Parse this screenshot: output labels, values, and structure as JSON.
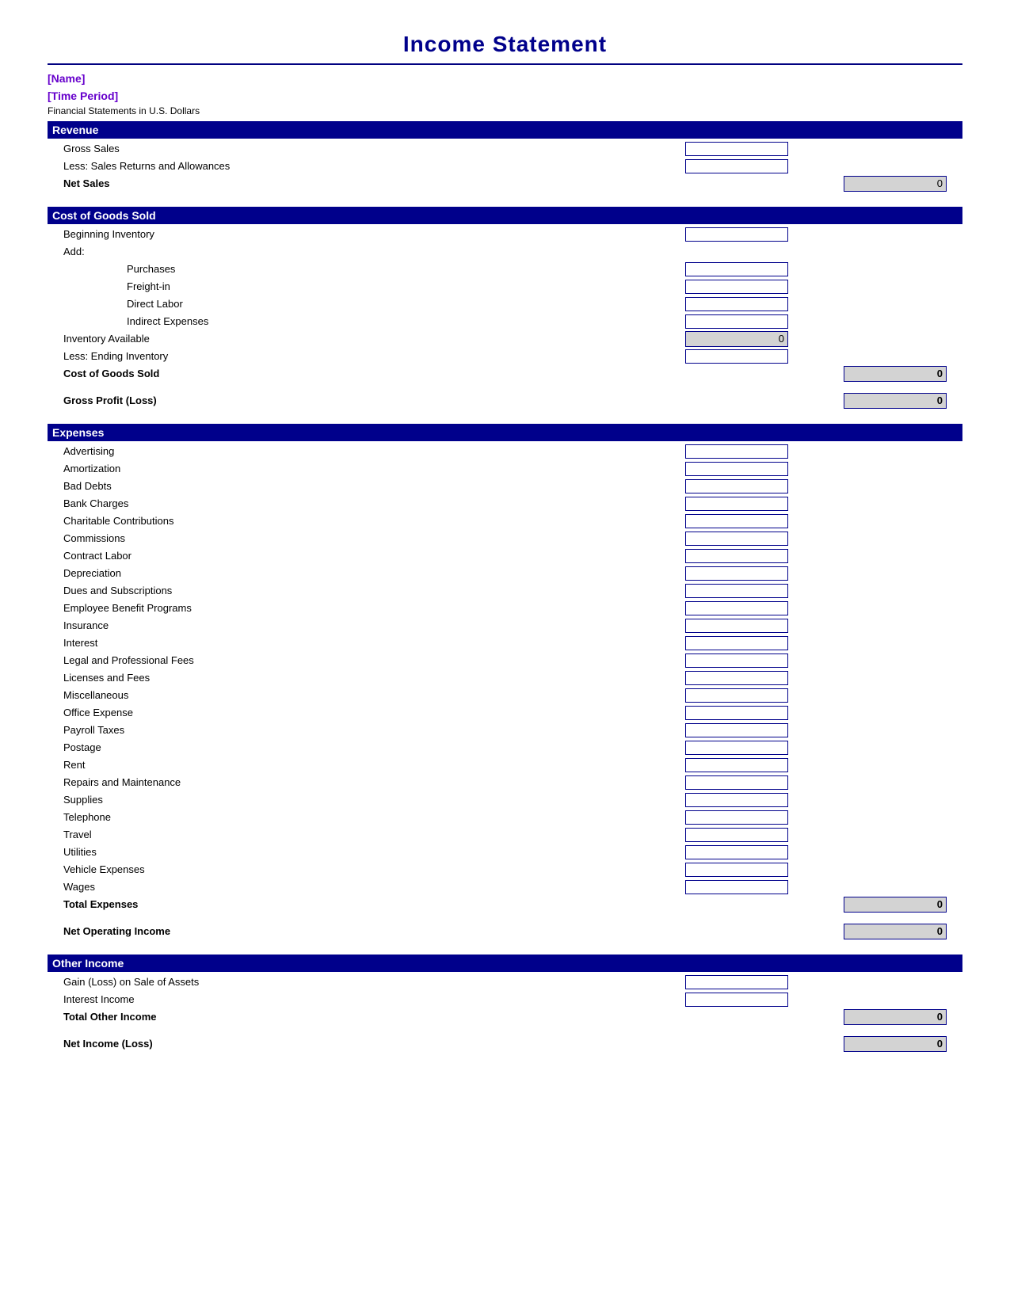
{
  "title": "Income Statement",
  "name_label": "[Name]",
  "period_label": "[Time Period]",
  "currency_note": "Financial Statements in U.S. Dollars",
  "sections": {
    "revenue": {
      "header": "Revenue",
      "items": [
        {
          "label": "Gross Sales",
          "indent": 1
        },
        {
          "label": "Less: Sales Returns and Allowances",
          "indent": 1
        },
        {
          "label": "Net Sales",
          "indent": 1,
          "bold": true,
          "total": true,
          "value": "0"
        }
      ]
    },
    "cogs": {
      "header": "Cost of Goods Sold",
      "items": [
        {
          "label": "Beginning Inventory",
          "indent": 1
        },
        {
          "label": "Add:",
          "indent": 1
        },
        {
          "label": "Purchases",
          "indent": 2
        },
        {
          "label": "Freight-in",
          "indent": 2
        },
        {
          "label": "Direct Labor",
          "indent": 2
        },
        {
          "label": "Indirect Expenses",
          "indent": 2
        },
        {
          "label": "Inventory Available",
          "indent": 1,
          "subtotal": true,
          "value": "0"
        },
        {
          "label": "Less: Ending Inventory",
          "indent": 1
        },
        {
          "label": "Cost of Goods Sold",
          "indent": 1,
          "bold": true,
          "total": true,
          "value": "0"
        }
      ]
    },
    "gross_profit": {
      "label": "Gross Profit (Loss)",
      "bold": true,
      "total": true,
      "value": "0"
    },
    "expenses": {
      "header": "Expenses",
      "items": [
        {
          "label": "Advertising",
          "indent": 1
        },
        {
          "label": "Amortization",
          "indent": 1
        },
        {
          "label": "Bad Debts",
          "indent": 1
        },
        {
          "label": "Bank Charges",
          "indent": 1
        },
        {
          "label": "Charitable Contributions",
          "indent": 1
        },
        {
          "label": "Commissions",
          "indent": 1
        },
        {
          "label": "Contract Labor",
          "indent": 1
        },
        {
          "label": "Depreciation",
          "indent": 1
        },
        {
          "label": "Dues and Subscriptions",
          "indent": 1
        },
        {
          "label": "Employee Benefit Programs",
          "indent": 1
        },
        {
          "label": "Insurance",
          "indent": 1
        },
        {
          "label": "Interest",
          "indent": 1
        },
        {
          "label": "Legal and Professional Fees",
          "indent": 1
        },
        {
          "label": "Licenses and Fees",
          "indent": 1
        },
        {
          "label": "Miscellaneous",
          "indent": 1
        },
        {
          "label": "Office Expense",
          "indent": 1
        },
        {
          "label": "Payroll Taxes",
          "indent": 1
        },
        {
          "label": "Postage",
          "indent": 1
        },
        {
          "label": "Rent",
          "indent": 1
        },
        {
          "label": "Repairs and Maintenance",
          "indent": 1
        },
        {
          "label": "Supplies",
          "indent": 1
        },
        {
          "label": "Telephone",
          "indent": 1
        },
        {
          "label": "Travel",
          "indent": 1
        },
        {
          "label": "Utilities",
          "indent": 1
        },
        {
          "label": "Vehicle Expenses",
          "indent": 1
        },
        {
          "label": "Wages",
          "indent": 1
        },
        {
          "label": "Total Expenses",
          "indent": 1,
          "bold": true,
          "total": true,
          "value": "0"
        }
      ]
    },
    "net_operating_income": {
      "label": "Net Operating Income",
      "bold": true,
      "total": true,
      "value": "0"
    },
    "other_income": {
      "header": "Other Income",
      "items": [
        {
          "label": "Gain (Loss) on Sale of Assets",
          "indent": 1
        },
        {
          "label": "Interest Income",
          "indent": 1
        },
        {
          "label": "Total Other Income",
          "indent": 1,
          "bold": true,
          "total": true,
          "value": "0"
        }
      ]
    },
    "net_income": {
      "label": "Net Income (Loss)",
      "bold": true,
      "total": true,
      "value": "0"
    }
  },
  "colors": {
    "header_bg": "#00008B",
    "header_text": "#ffffff",
    "input_border": "#00008B",
    "total_bg": "#d3d3d3",
    "name_color": "#6600cc",
    "title_color": "#00008B"
  }
}
